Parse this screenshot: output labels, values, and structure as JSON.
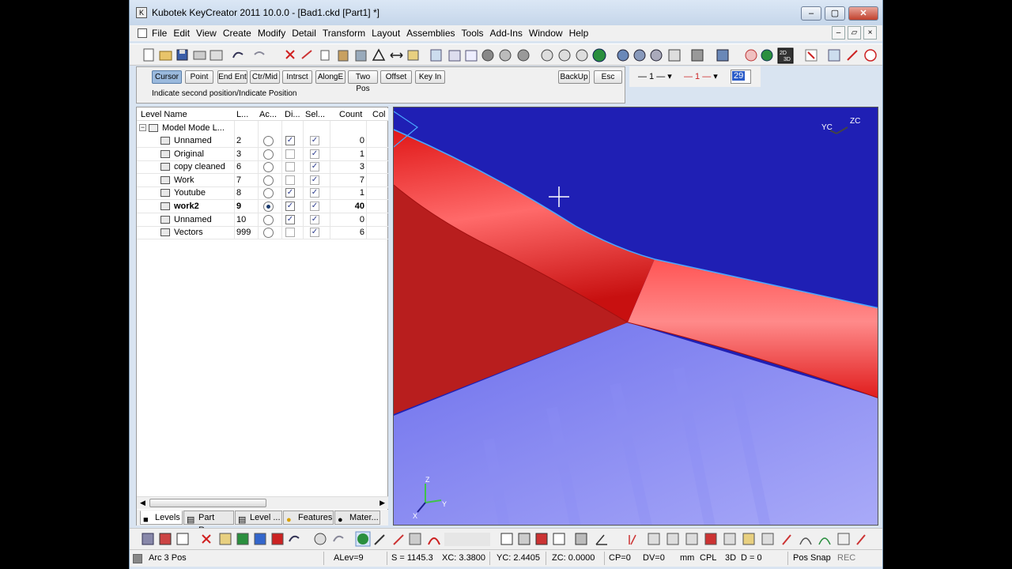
{
  "window": {
    "title": "Kubotek KeyCreator 2011 10.0.0 - [Bad1.ckd [Part1] *]"
  },
  "menu": [
    "File",
    "Edit",
    "View",
    "Create",
    "Modify",
    "Detail",
    "Transform",
    "Layout",
    "Assemblies",
    "Tools",
    "Add-Ins",
    "Window",
    "Help"
  ],
  "prompt": {
    "buttons": [
      "Cursor",
      "Point",
      "End Ent",
      "Ctr/Mid",
      "Intrsct",
      "AlongE",
      "Two Pos",
      "Offset",
      "Key In"
    ],
    "backup": "BackUp",
    "esc": "Esc",
    "text": "Indicate second position/Indicate Position"
  },
  "linebar": {
    "style1": "— 1 —",
    "style2": "— 1 —",
    "level": "29"
  },
  "levels": {
    "headers": [
      "Level Name",
      "L...",
      "Ac...",
      "Di...",
      "Sel...",
      "Count",
      "Col"
    ],
    "root": "Model Mode L...",
    "rows": [
      {
        "name": "Unnamed",
        "num": "2",
        "active": false,
        "display": true,
        "select": true,
        "count": "0",
        "bold": false
      },
      {
        "name": "Original",
        "num": "3",
        "active": false,
        "display": false,
        "select": true,
        "count": "1",
        "bold": false
      },
      {
        "name": "copy cleaned",
        "num": "6",
        "active": false,
        "display": false,
        "select": true,
        "count": "3",
        "bold": false
      },
      {
        "name": "Work",
        "num": "7",
        "active": false,
        "display": false,
        "select": true,
        "count": "7",
        "bold": false
      },
      {
        "name": "Youtube",
        "num": "8",
        "active": false,
        "display": true,
        "select": true,
        "count": "1",
        "bold": false
      },
      {
        "name": "work2",
        "num": "9",
        "active": true,
        "display": true,
        "select": true,
        "count": "40",
        "bold": true
      },
      {
        "name": "Unnamed",
        "num": "10",
        "active": false,
        "display": true,
        "select": true,
        "count": "0",
        "bold": false
      },
      {
        "name": "Vectors",
        "num": "999",
        "active": false,
        "display": false,
        "select": true,
        "count": "6",
        "bold": false
      }
    ]
  },
  "tabs": [
    "Levels",
    "Part Re...",
    "Level ...",
    "Features",
    "Mater..."
  ],
  "viewport": {
    "axis_top_y": "YC",
    "axis_top_z": "ZC",
    "axis_bot_z": "Z",
    "axis_bot_y": "Y",
    "axis_bot_x": "X"
  },
  "status": {
    "mode": "Arc 3 Pos",
    "alev": "ALev=9",
    "s": "S = 1145.3",
    "xc": "XC: 3.3800",
    "yc": "YC: 2.4405",
    "zc": "ZC: 0.0000",
    "cp": "CP=0",
    "dv": "DV=0",
    "mm": "mm",
    "cpl": "CPL",
    "d3": "3D",
    "d": "D = 0",
    "snap": "Pos Snap",
    "rec": "REC"
  },
  "colors": {
    "background": "#1f1fb4",
    "part_red": "#e8202a",
    "floor_blue": "#7a7cf0"
  }
}
